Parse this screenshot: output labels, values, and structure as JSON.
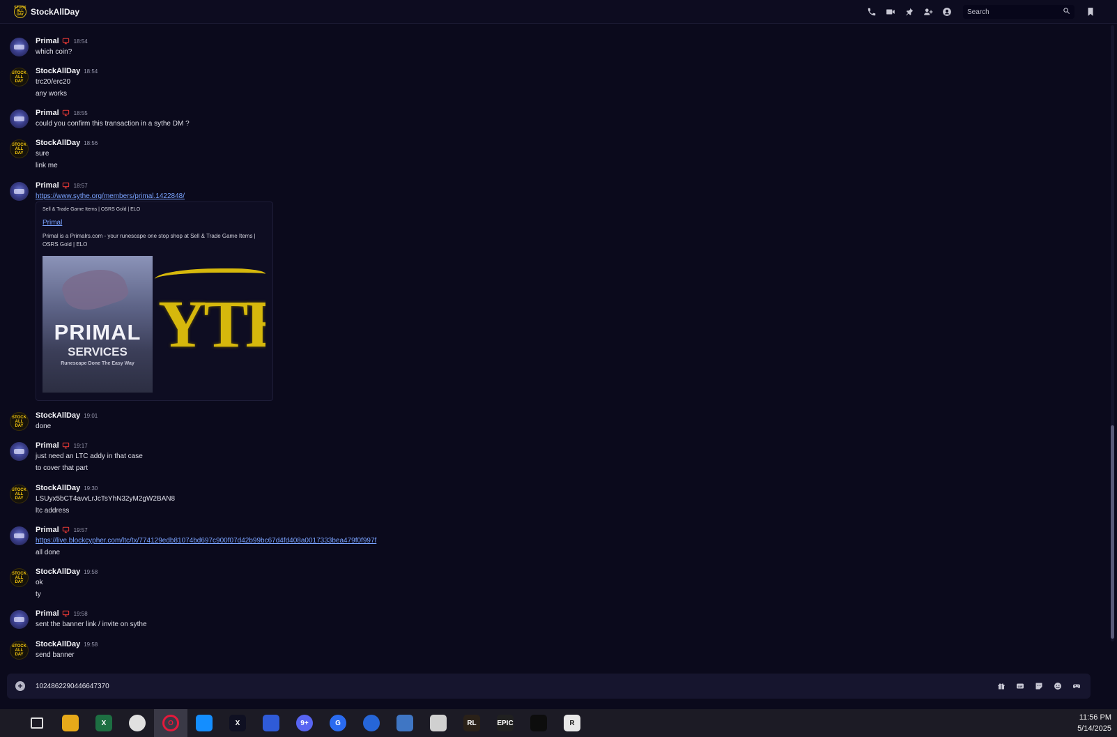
{
  "header": {
    "channel_name": "StockAllDay",
    "avatar_text": "STOCK ALL DAY",
    "search_placeholder": "Search",
    "icons": [
      "phone-call-icon",
      "video-camera-icon",
      "pin-icon",
      "add-friend-icon",
      "user-profile-icon",
      "search-icon",
      "inbox-icon"
    ]
  },
  "messages": [
    {
      "user": "Primal",
      "time": "18:54",
      "lines": [
        "which coin?"
      ]
    },
    {
      "user": "StockAllDay",
      "time": "18:54",
      "lines": [
        "trc20/erc20",
        "any works"
      ]
    },
    {
      "user": "Primal",
      "time": "18:55",
      "lines": [
        "could you confirm this transaction in a sythe DM ?"
      ]
    },
    {
      "user": "StockAllDay",
      "time": "18:56",
      "lines": [
        "sure",
        "link me"
      ]
    },
    {
      "user": "Primal",
      "time": "18:57",
      "link": "https://www.sythe.org/members/primal.1422848/"
    },
    {
      "user": "StockAllDay",
      "time": "19:01",
      "lines": [
        "done"
      ]
    },
    {
      "user": "Primal",
      "time": "19:17",
      "lines": [
        "just need an LTC addy in that case",
        "to cover that part"
      ]
    },
    {
      "user": "StockAllDay",
      "time": "19:30",
      "lines": [
        "LSUyx5bCT4avvLrJcTsYhN32yM2gW2BAN8",
        "ltc address"
      ]
    },
    {
      "user": "Primal",
      "time": "19:57",
      "link": "https://live.blockcypher.com/ltc/tx/774129edb81074bd697c900f07d42b99bc67d4fd408a0017333bea479f0f997f",
      "lines": [
        "all done"
      ]
    },
    {
      "user": "StockAllDay",
      "time": "19:58",
      "lines": [
        "ok",
        "ty"
      ]
    },
    {
      "user": "Primal",
      "time": "19:58",
      "lines": [
        "sent the banner link / invite on sythe"
      ]
    },
    {
      "user": "StockAllDay",
      "time": "19:58",
      "lines": [
        "send banner"
      ]
    }
  ],
  "embed": {
    "provider": "Sell & Trade Game Items | OSRS Gold | ELO",
    "title": "Primal",
    "description": "Primal is a Primalrs.com - your runescape one stop shop at Sell & Trade Game Items | OSRS Gold | ELO",
    "image1_title": "PRIMAL",
    "image1_subtitle": "SERVICES",
    "image1_tagline": "Runescape Done The Easy Way",
    "image2_text": "YTE"
  },
  "avatar_text": {
    "stock": "STOCK ALL DAY"
  },
  "composer": {
    "value": "1024862290446647370",
    "icons": [
      "gift-icon",
      "gif-icon",
      "sticker-icon",
      "emoji-icon",
      "game-controller-icon"
    ]
  },
  "taskbar": {
    "time": "11:56 PM",
    "date": "5/14/2025",
    "apps": [
      {
        "name": "task-view",
        "label": "",
        "color": "#1c1b25"
      },
      {
        "name": "file-explorer",
        "label": "",
        "color": "#e6a91a"
      },
      {
        "name": "excel",
        "label": "X",
        "color": "#1d6f42"
      },
      {
        "name": "chrome",
        "label": "",
        "color": "#e0e0e0"
      },
      {
        "name": "opera-gx",
        "label": "O",
        "color": "#e5193b"
      },
      {
        "name": "battle-net",
        "label": "",
        "color": "#148eff"
      },
      {
        "name": "capcut-x",
        "label": "X",
        "color": "#0f1022"
      },
      {
        "name": "app-blue",
        "label": "",
        "color": "#2f5bd8"
      },
      {
        "name": "discord",
        "label": "9+",
        "color": "#5865f2"
      },
      {
        "name": "app-g",
        "label": "G",
        "color": "#2a6bf0"
      },
      {
        "name": "app-arrow",
        "label": "",
        "color": "#2666d8"
      },
      {
        "name": "remote-desktop",
        "label": "",
        "color": "#3f76c4"
      },
      {
        "name": "settings",
        "label": "",
        "color": "#d0d0d0"
      },
      {
        "name": "runelite",
        "label": "RL",
        "color": "#2a2118"
      },
      {
        "name": "epic-games",
        "label": "EPIC",
        "color": "#202020"
      },
      {
        "name": "capcut",
        "label": "",
        "color": "#0d0d0d"
      },
      {
        "name": "r-app",
        "label": "R",
        "color": "#e8e8e8"
      }
    ]
  }
}
